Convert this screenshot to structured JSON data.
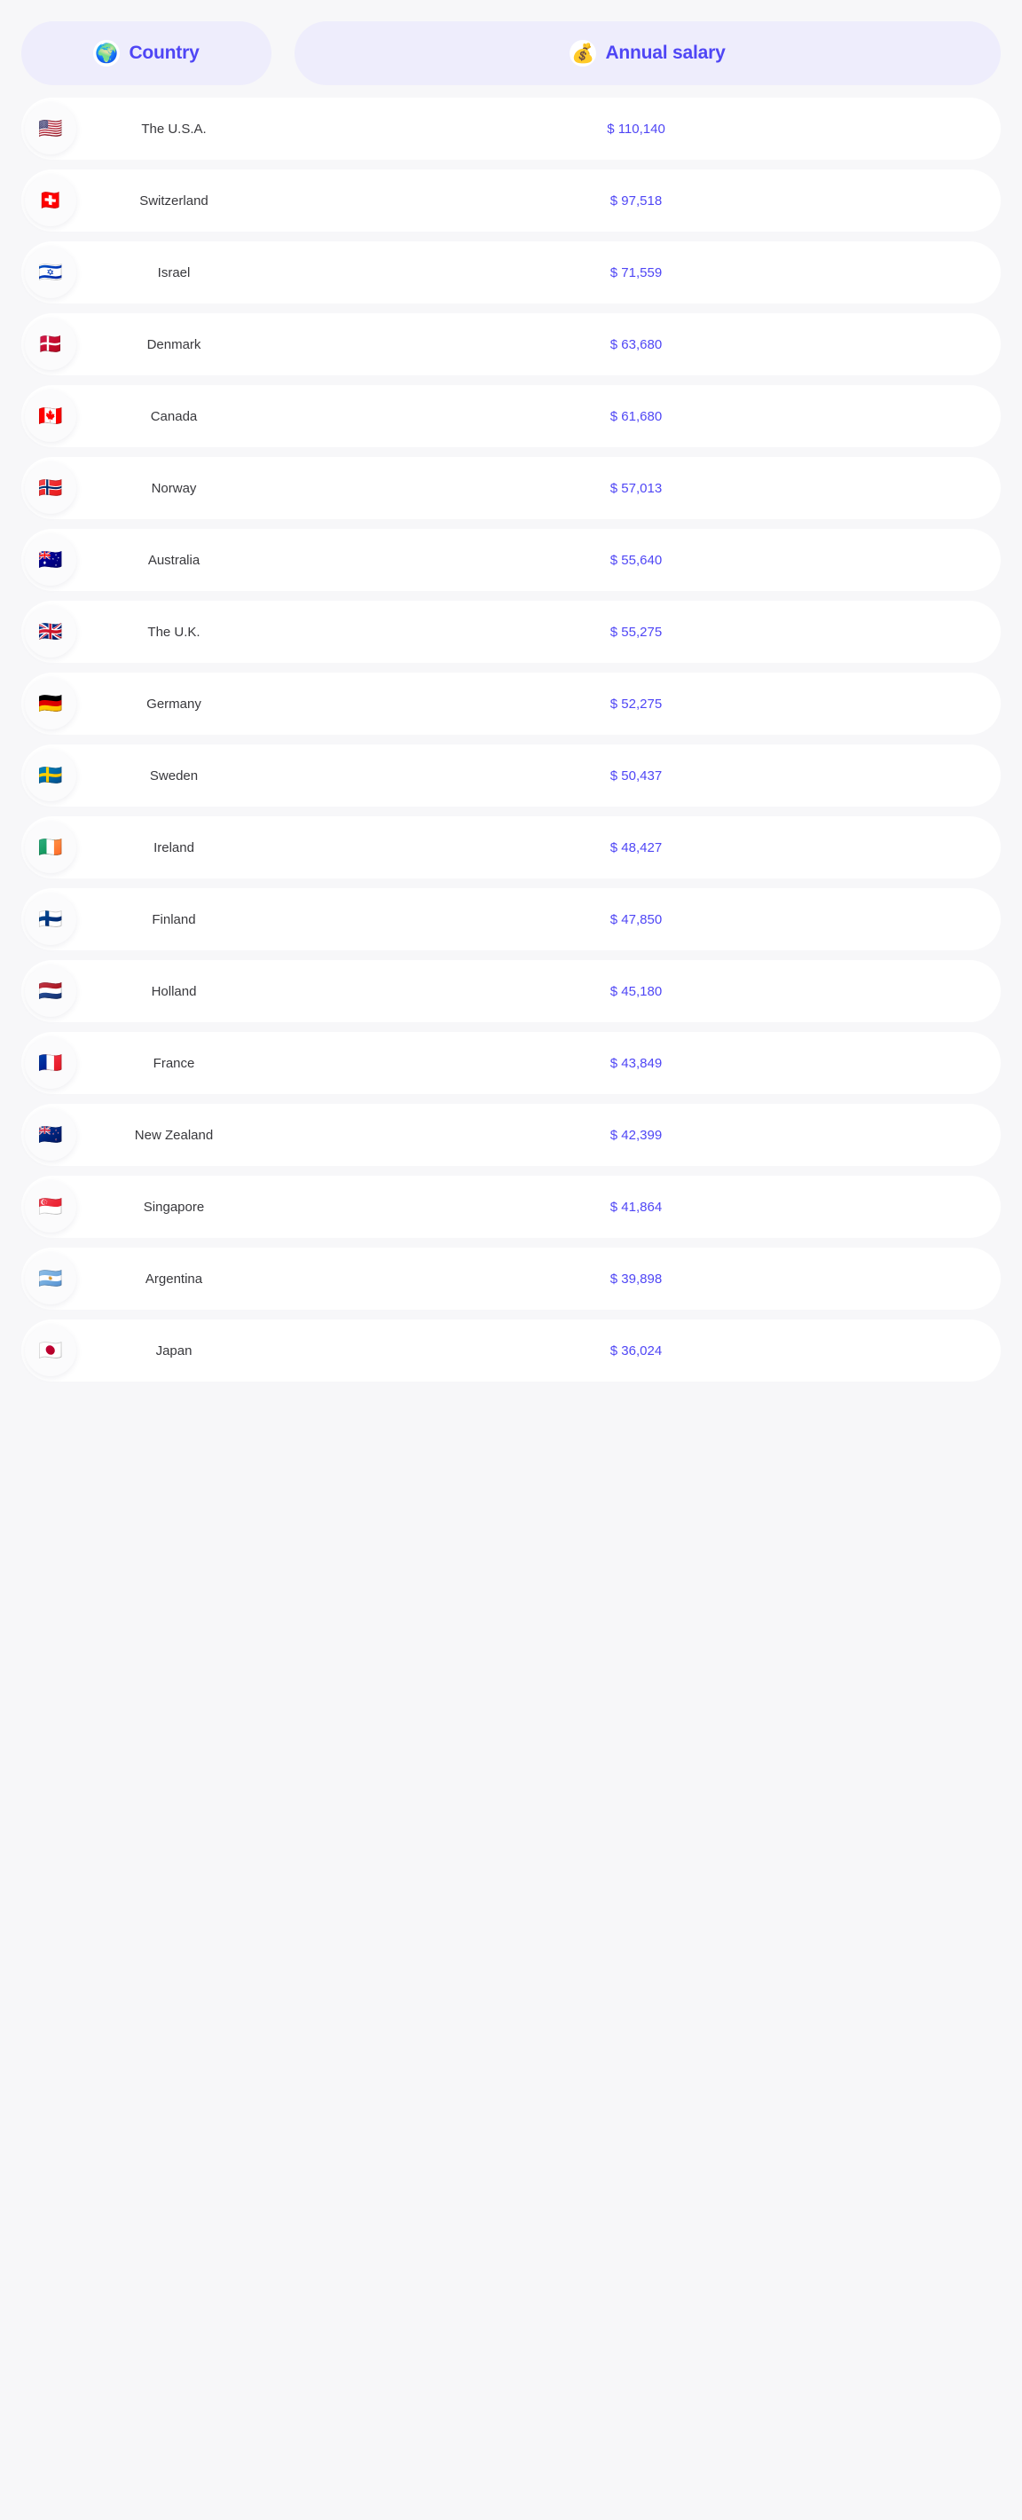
{
  "page": {
    "background_color": "#f7f7f9",
    "accent_color": "#4f46f5",
    "header_pill_color": "#eeedfc",
    "card_color": "#ffffff"
  },
  "header": {
    "columns": [
      {
        "icon": "globe-icon",
        "glyph": "🌍",
        "label": "Country"
      },
      {
        "icon": "money-bag-icon",
        "glyph": "💰",
        "label": "Annual salary"
      }
    ]
  },
  "table": {
    "rows": [
      {
        "flag": "flag-us",
        "glyph": "🇺🇸",
        "country": "The U.S.A.",
        "salary": "$ 110,140"
      },
      {
        "flag": "flag-switzerland",
        "glyph": "🇨🇭",
        "country": "Switzerland",
        "salary": "$ 97,518"
      },
      {
        "flag": "flag-israel",
        "glyph": "🇮🇱",
        "country": "Israel",
        "salary": "$ 71,559"
      },
      {
        "flag": "flag-denmark",
        "glyph": "🇩🇰",
        "country": "Denmark",
        "salary": "$ 63,680"
      },
      {
        "flag": "flag-canada",
        "glyph": "🇨🇦",
        "country": "Canada",
        "salary": "$ 61,680"
      },
      {
        "flag": "flag-norway",
        "glyph": "🇳🇴",
        "country": "Norway",
        "salary": "$ 57,013"
      },
      {
        "flag": "flag-australia",
        "glyph": "🇦🇺",
        "country": "Australia",
        "salary": "$ 55,640"
      },
      {
        "flag": "flag-uk",
        "glyph": "🇬🇧",
        "country": "The U.K.",
        "salary": "$ 55,275"
      },
      {
        "flag": "flag-germany",
        "glyph": "🇩🇪",
        "country": "Germany",
        "salary": "$ 52,275"
      },
      {
        "flag": "flag-sweden",
        "glyph": "🇸🇪",
        "country": "Sweden",
        "salary": "$ 50,437"
      },
      {
        "flag": "flag-ireland",
        "glyph": "🇮🇪",
        "country": "Ireland",
        "salary": "$ 48,427"
      },
      {
        "flag": "flag-finland",
        "glyph": "🇫🇮",
        "country": "Finland",
        "salary": "$ 47,850"
      },
      {
        "flag": "flag-holland",
        "glyph": "🇳🇱",
        "country": "Holland",
        "salary": "$ 45,180"
      },
      {
        "flag": "flag-france",
        "glyph": "🇫🇷",
        "country": "France",
        "salary": "$ 43,849"
      },
      {
        "flag": "flag-new-zealand",
        "glyph": "🇳🇿",
        "country": "New Zealand",
        "salary": "$ 42,399"
      },
      {
        "flag": "flag-singapore",
        "glyph": "🇸🇬",
        "country": "Singapore",
        "salary": "$ 41,864"
      },
      {
        "flag": "flag-argentina",
        "glyph": "🇦🇷",
        "country": "Argentina",
        "salary": "$ 39,898"
      },
      {
        "flag": "flag-japan",
        "glyph": "🇯🇵",
        "country": "Japan",
        "salary": "$ 36,024"
      }
    ]
  }
}
